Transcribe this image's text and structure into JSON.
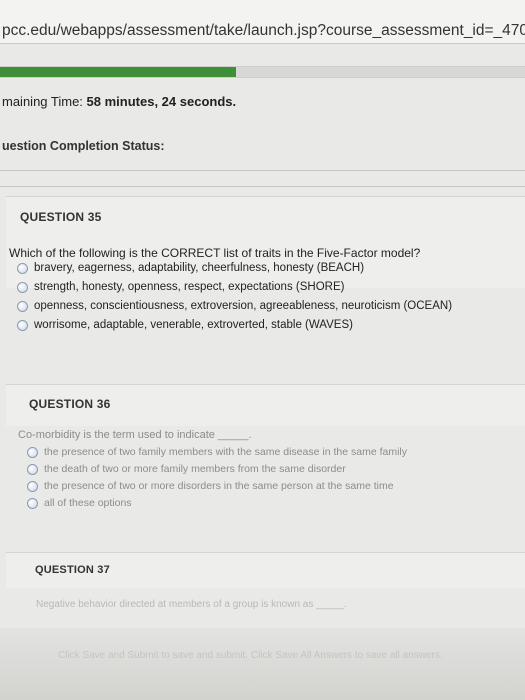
{
  "browser": {
    "url": "pcc.edu/webapps/assessment/take/launch.jsp?course_assessment_id=_470"
  },
  "timer": {
    "label": "maining Time:",
    "value": "58 minutes, 24 seconds."
  },
  "progress": {
    "fraction": 0.45
  },
  "completion_status": {
    "label": "uestion Completion Status:"
  },
  "questions": [
    {
      "header": "QUESTION 35",
      "text": "Which of the following is the CORRECT list of traits in the Five-Factor model?",
      "options": [
        "bravery, eagerness, adaptability, cheerfulness, honesty (BEACH)",
        "strength, honesty, openness, respect, expectations (SHORE)",
        "openness, conscientiousness, extroversion, agreeableness, neuroticism (OCEAN)",
        "worrisome, adaptable, venerable, extroverted, stable (WAVES)"
      ]
    },
    {
      "header": "QUESTION 36",
      "text": "Co-morbidity is the term used to indicate _____.",
      "options": [
        "the presence of two family members with the same disease in the same family",
        "the death of two or more family members from the same disorder",
        "the presence of two or more disorders in the same person at the same time",
        "all of these options"
      ]
    },
    {
      "header": "QUESTION 37",
      "text": "Negative behavior directed at members of a group is known as _____."
    }
  ],
  "footer": {
    "text": "Click Save and Submit to save and submit. Click Save All Answers to save all answers."
  }
}
